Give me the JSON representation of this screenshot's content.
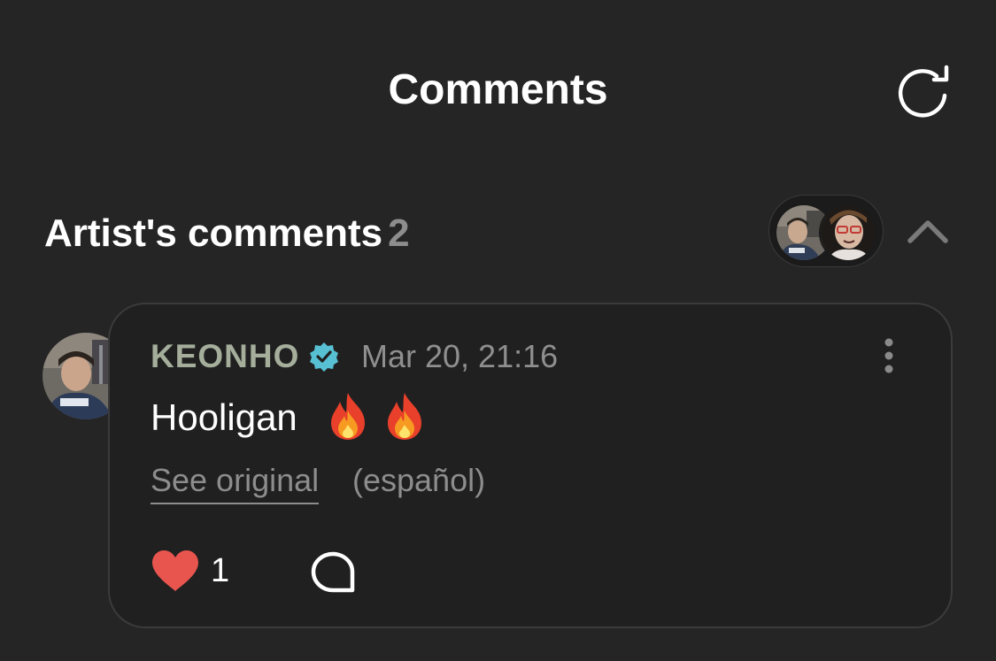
{
  "header": {
    "title": "Comments",
    "refresh_icon": "refresh-icon"
  },
  "artist_section": {
    "title": "Artist's comments",
    "count": "2",
    "avatars": [
      "artist-avatar-1",
      "artist-avatar-2"
    ],
    "collapse_icon": "chevron-up-icon"
  },
  "comment": {
    "author": "KEONHO",
    "verified_icon": "verified-badge-icon",
    "timestamp": "Mar 20, 21:16",
    "text": "Hooligan",
    "emojis": [
      "flame-icon",
      "flame-icon"
    ],
    "see_original_label": "See original",
    "original_language": "(español)",
    "likes": "1",
    "like_icon": "heart-icon",
    "reply_icon": "reply-bubble-icon",
    "more_icon": "more-vertical-icon"
  },
  "colors": {
    "background": "#252525",
    "card": "#202020",
    "author": "#a4ae9b",
    "verified": "#57c1d3",
    "heart": "#e8554e",
    "muted": "#8d8d8d"
  }
}
